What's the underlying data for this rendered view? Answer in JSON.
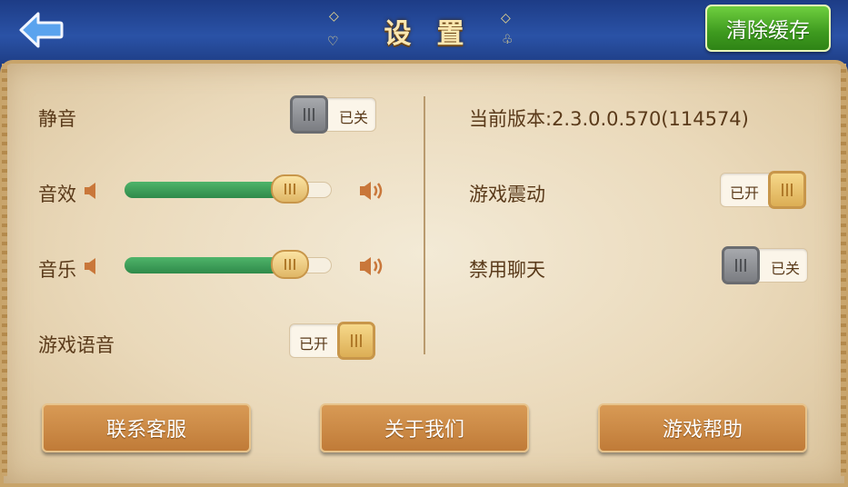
{
  "header": {
    "title": "设置",
    "clear_cache_label": "清除缓存"
  },
  "settings": {
    "mute": {
      "label": "静音",
      "state_text": "已关",
      "on": false
    },
    "sound_effect": {
      "label": "音效",
      "level": 0.8
    },
    "music": {
      "label": "音乐",
      "level": 0.8
    },
    "game_voice": {
      "label": "游戏语音",
      "state_text": "已开",
      "on": true
    },
    "version_text": "当前版本:2.3.0.0.570(114574)",
    "vibration": {
      "label": "游戏震动",
      "state_text": "已开",
      "on": true
    },
    "disable_chat": {
      "label": "禁用聊天",
      "state_text": "已关",
      "on": false
    }
  },
  "buttons": {
    "contact_support": "联系客服",
    "about_us": "关于我们",
    "game_help": "游戏帮助"
  },
  "colors": {
    "header_blue": "#2a52a6",
    "clear_green": "#3e9a1f",
    "button_brown": "#c07b38",
    "slider_green": "#2f8a4a"
  }
}
